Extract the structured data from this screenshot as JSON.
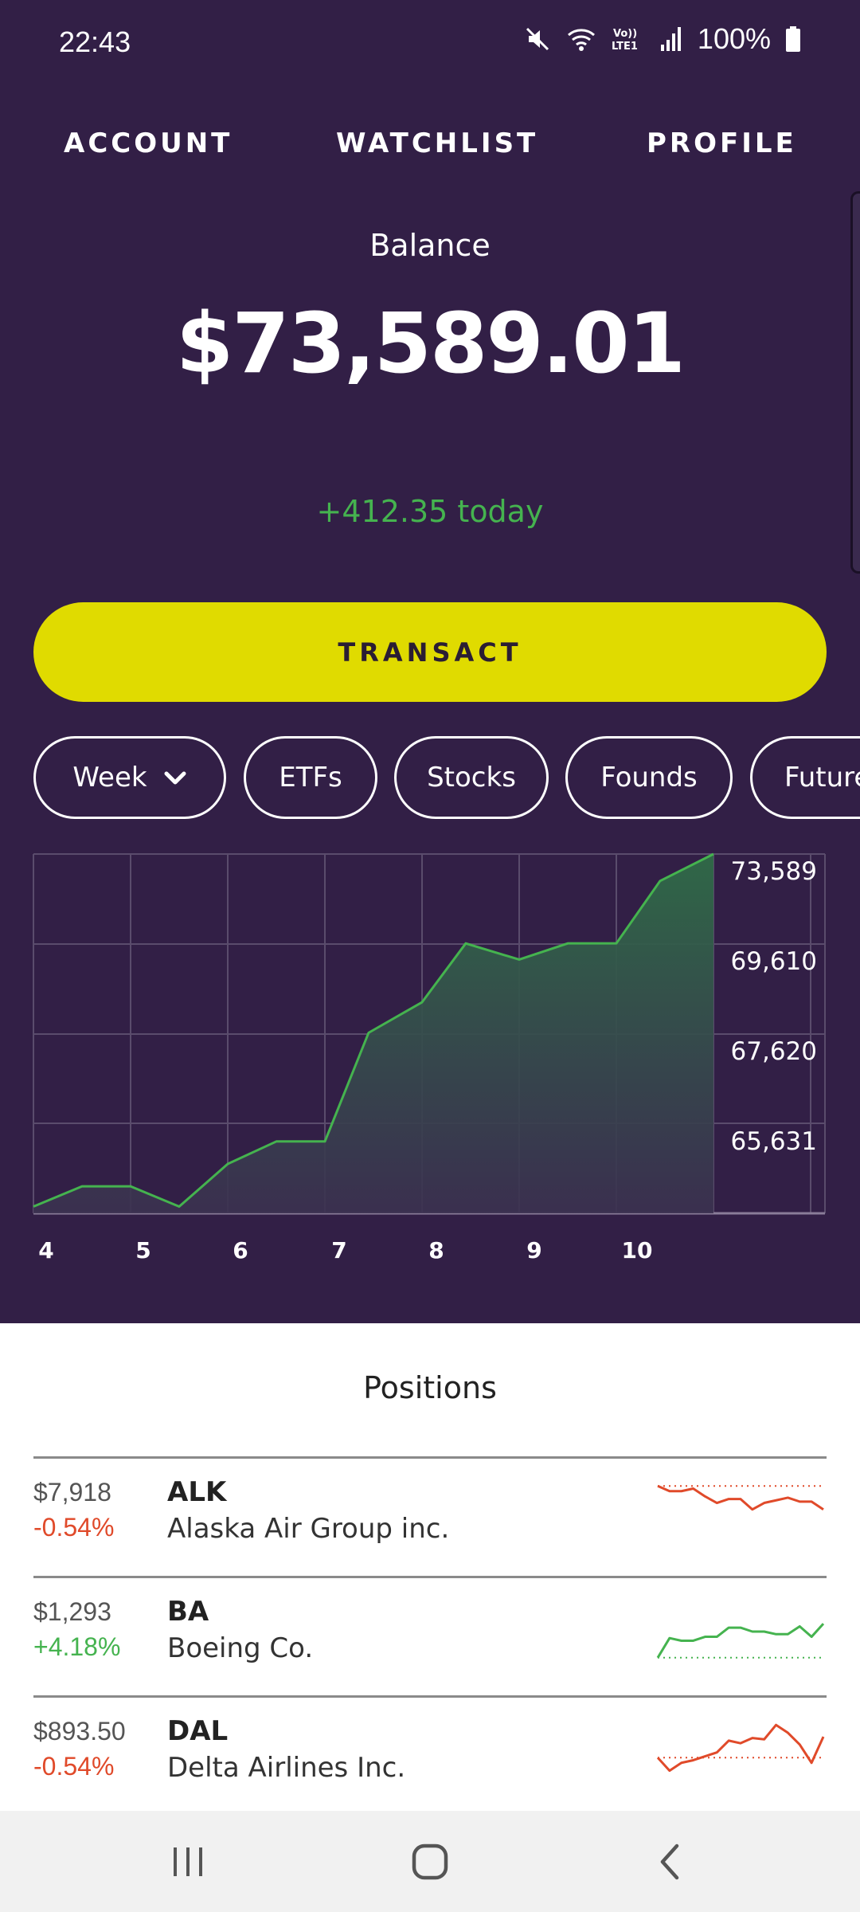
{
  "status_bar": {
    "time": "22:43",
    "battery_percent": "100%",
    "icons": [
      "mute-icon",
      "wifi-icon",
      "volte-icon",
      "signal-icon",
      "battery-icon"
    ]
  },
  "nav": {
    "items": [
      {
        "label": "ACCOUNT"
      },
      {
        "label": "WATCHLIST"
      },
      {
        "label": "PROFILE"
      }
    ]
  },
  "balance": {
    "label": "Balance",
    "value": "$73,589.01",
    "change": "+412.35 today"
  },
  "transact_label": "TRANSACT",
  "filters": [
    {
      "label": "Week",
      "icon": "chevron-down-icon"
    },
    {
      "label": "ETFs"
    },
    {
      "label": "Stocks"
    },
    {
      "label": "Founds"
    },
    {
      "label": "Futures"
    }
  ],
  "colors": {
    "background": "#321f46",
    "accent_yellow": "#e0db00",
    "positive": "#45b34f",
    "negative": "#e04a2a"
  },
  "chart_data": {
    "type": "area",
    "x_ticks": [
      "4",
      "5",
      "6",
      "7",
      "8",
      "9",
      "10"
    ],
    "y_ticks": [
      "73,589",
      "69,610",
      "67,620",
      "65,631"
    ],
    "grid": true,
    "series": [
      {
        "x": [
          4.0,
          4.5,
          5.0,
          5.5,
          6.0,
          6.5,
          7.0,
          7.45,
          8.0,
          8.45,
          9.0,
          9.5,
          10.0,
          10.45,
          11.0
        ],
        "values": [
          63750,
          64200,
          64200,
          63750,
          64700,
          65200,
          65200,
          67620,
          68300,
          69610,
          69250,
          69610,
          69610,
          71000,
          71600
        ]
      }
    ]
  },
  "positions": {
    "title": "Positions",
    "items": [
      {
        "price": "$7,918",
        "change": "-0.54%",
        "direction": "down",
        "ticker": "ALK",
        "name": "Alaska Air Group inc.",
        "spark": [
          9,
          8.2,
          8.2,
          8.6,
          7.4,
          6.4,
          7.0,
          7.0,
          5.4,
          6.4,
          6.8,
          7.2,
          6.6,
          6.6,
          5.4
        ],
        "spark_baseline": 9
      },
      {
        "price": "$1,293",
        "change": "+4.18%",
        "direction": "up",
        "ticker": "BA",
        "name": "Boeing Co.",
        "spark": [
          1.0,
          4.0,
          3.6,
          3.6,
          4.2,
          4.2,
          5.6,
          5.6,
          5.0,
          5.0,
          4.6,
          4.6,
          5.8,
          4.2,
          6.2
        ],
        "spark_baseline": 1
      },
      {
        "price": "$893.50",
        "change": "-0.54%",
        "direction": "down",
        "ticker": "DAL",
        "name": "Delta Airlines Inc.",
        "spark": [
          4.0,
          2.0,
          3.2,
          3.6,
          4.2,
          4.8,
          6.6,
          6.2,
          7.0,
          6.8,
          9.0,
          7.8,
          6.0,
          3.2,
          7.2
        ],
        "spark_baseline": 4
      }
    ]
  },
  "system_nav": [
    "recents-icon",
    "home-icon",
    "back-icon"
  ]
}
